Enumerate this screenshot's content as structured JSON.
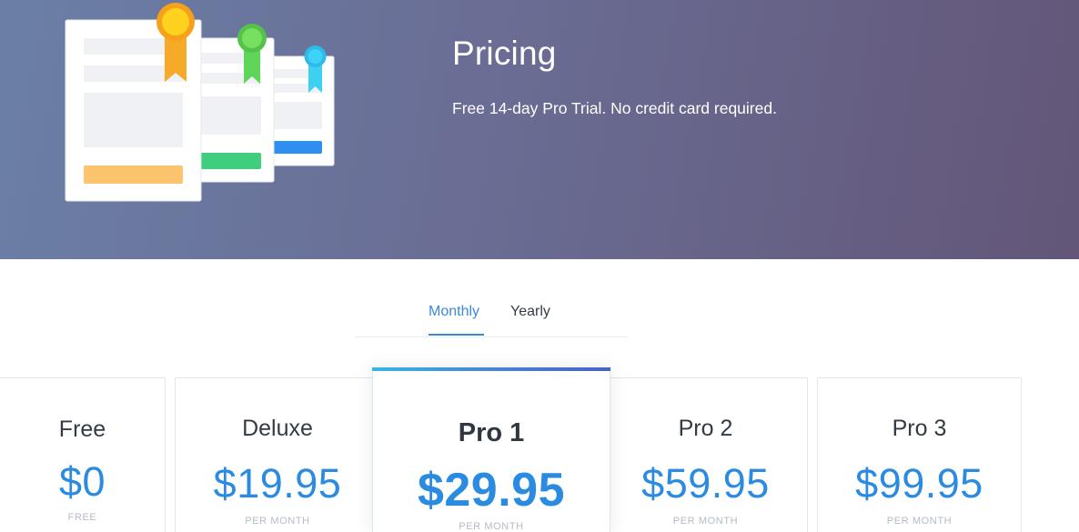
{
  "hero": {
    "title": "Pricing",
    "subtitle": "Free 14-day Pro Trial. No credit card required.",
    "illustration_icon": "pricing-plans-illustration"
  },
  "billing_tabs": [
    {
      "label": "Monthly",
      "active": true
    },
    {
      "label": "Yearly",
      "active": false
    }
  ],
  "plans": [
    {
      "name": "Free",
      "price": "$0",
      "period": "FREE",
      "featured": false
    },
    {
      "name": "Deluxe",
      "price": "$19.95",
      "period": "PER MONTH",
      "featured": false
    },
    {
      "name": "Pro 1",
      "price": "$29.95",
      "period": "PER MONTH",
      "featured": true
    },
    {
      "name": "Pro 2",
      "price": "$59.95",
      "period": "PER MONTH",
      "featured": false
    },
    {
      "name": "Pro 3",
      "price": "$99.95",
      "period": "PER MONTH",
      "featured": false
    }
  ],
  "colors": {
    "accent": "#2b8be0",
    "tab_active": "#3a8bd8",
    "hero_gradient_start": "#6b7fa6",
    "hero_gradient_end": "#635678",
    "ribbon_gold": "#f7a928",
    "ribbon_green": "#6ad55a",
    "ribbon_blue": "#38c0f0"
  }
}
